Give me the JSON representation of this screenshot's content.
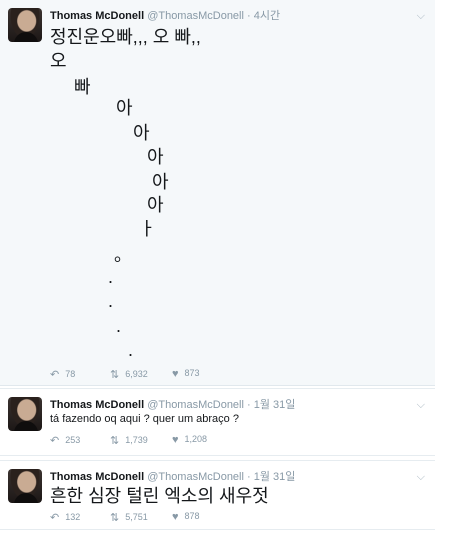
{
  "tweets": [
    {
      "name": "Thomas McDonell",
      "handle": "@ThomasMcDonell",
      "dot": "·",
      "time": "4시간",
      "lines": [
        "정진운오빠,,, 오 빠,,",
        "오",
        "빠",
        "아",
        "아",
        "아",
        "아",
        "아",
        "ㅏ",
        "。",
        ".",
        ".",
        ".",
        "."
      ],
      "actions": {
        "reply": "78",
        "retweet": "6,932",
        "like": "873"
      }
    },
    {
      "name": "Thomas McDonell",
      "handle": "@ThomasMcDonell",
      "dot": "·",
      "time": "1월 31일",
      "text": "tá fazendo oq aqui ? quer um abraço ?",
      "actions": {
        "reply": "253",
        "retweet": "1,739",
        "like": "1,208"
      }
    },
    {
      "name": "Thomas McDonell",
      "handle": "@ThomasMcDonell",
      "dot": "·",
      "time": "1월 31일",
      "text": "흔한 심장 털린 엑소의 새우젓",
      "actions": {
        "reply": "132",
        "retweet": "5,751",
        "like": "878"
      }
    }
  ],
  "icons": {
    "reply": "reply-icon",
    "retweet": "retweet-icon",
    "like": "heart-icon",
    "menu": "chevron-down-icon"
  },
  "colors": {
    "meta": "#8899a6",
    "highlight_bg": "#f5f8fa"
  }
}
